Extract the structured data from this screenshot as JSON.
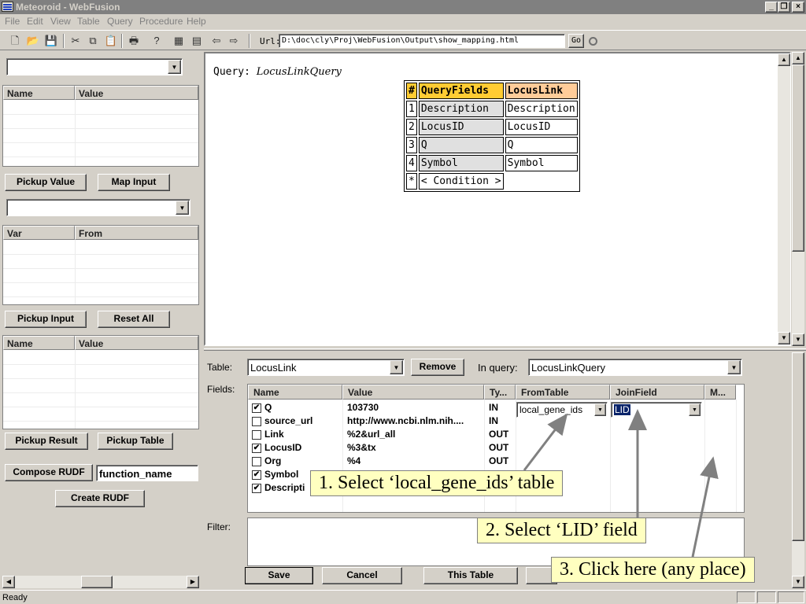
{
  "window": {
    "title": "Meteoroid - WebFusion"
  },
  "menu": [
    "File",
    "Edit",
    "View",
    "Table",
    "Query",
    "Procedure",
    "Help"
  ],
  "url": {
    "label": "Url:",
    "value": "D:\\doc\\cly\\Proj\\WebFusion\\Output\\show_mapping.html",
    "go": "Go"
  },
  "left": {
    "grid1": {
      "col1": "Name",
      "col2": "Value"
    },
    "pickup_value": "Pickup Value",
    "map_input": "Map Input",
    "grid2": {
      "col1": "Var",
      "col2": "From"
    },
    "pickup_input": "Pickup Input",
    "reset_all": "Reset All",
    "grid3": {
      "col1": "Name",
      "col2": "Value"
    },
    "pickup_result": "Pickup Result",
    "pickup_table": "Pickup Table",
    "compose_rudf": "Compose RUDF",
    "function_name": "function_name",
    "create_rudf": "Create RUDF"
  },
  "browser": {
    "query_label": "Query:",
    "query_name": "LocusLinkQuery",
    "table": {
      "headers": [
        "#",
        "QueryFields",
        "LocusLink"
      ],
      "rows": [
        [
          "1",
          "Description",
          "Description"
        ],
        [
          "2",
          "LocusID",
          "LocusID"
        ],
        [
          "3",
          "Q",
          "Q"
        ],
        [
          "4",
          "Symbol",
          "Symbol"
        ]
      ],
      "footer": [
        "*",
        "< Condition >"
      ]
    }
  },
  "bottom": {
    "table_label": "Table:",
    "table_value": "LocusLink",
    "remove": "Remove",
    "inquery_label": "In query:",
    "inquery_value": "LocusLinkQuery",
    "fields_label": "Fields:",
    "columns": [
      "Name",
      "Value",
      "Ty...",
      "FromTable",
      "JoinField",
      "M..."
    ],
    "rows": [
      {
        "checked": true,
        "name": "Q",
        "value": "103730",
        "type": "IN"
      },
      {
        "checked": false,
        "name": "source_url",
        "value": "http://www.ncbi.nlm.nih....",
        "type": "IN"
      },
      {
        "checked": false,
        "name": "Link",
        "value": "%2&url_all",
        "type": "OUT"
      },
      {
        "checked": true,
        "name": "LocusID",
        "value": "%3&tx",
        "type": "OUT"
      },
      {
        "checked": false,
        "name": "Org",
        "value": "%4",
        "type": "OUT"
      },
      {
        "checked": true,
        "name": "Symbol",
        "value": "",
        "type": ""
      },
      {
        "checked": true,
        "name": "Descripti",
        "value": "",
        "type": ""
      }
    ],
    "fromtable_value": "local_gene_ids",
    "joinfield_value": "LID",
    "filter_label": "Filter:",
    "save": "Save",
    "cancel": "Cancel",
    "this_table": "This Table"
  },
  "callouts": {
    "c1": "1. Select ‘local_gene_ids’ table",
    "c2": "2. Select ‘LID’ field",
    "c3": "3. Click here (any place)"
  },
  "status": {
    "text": "Ready"
  }
}
